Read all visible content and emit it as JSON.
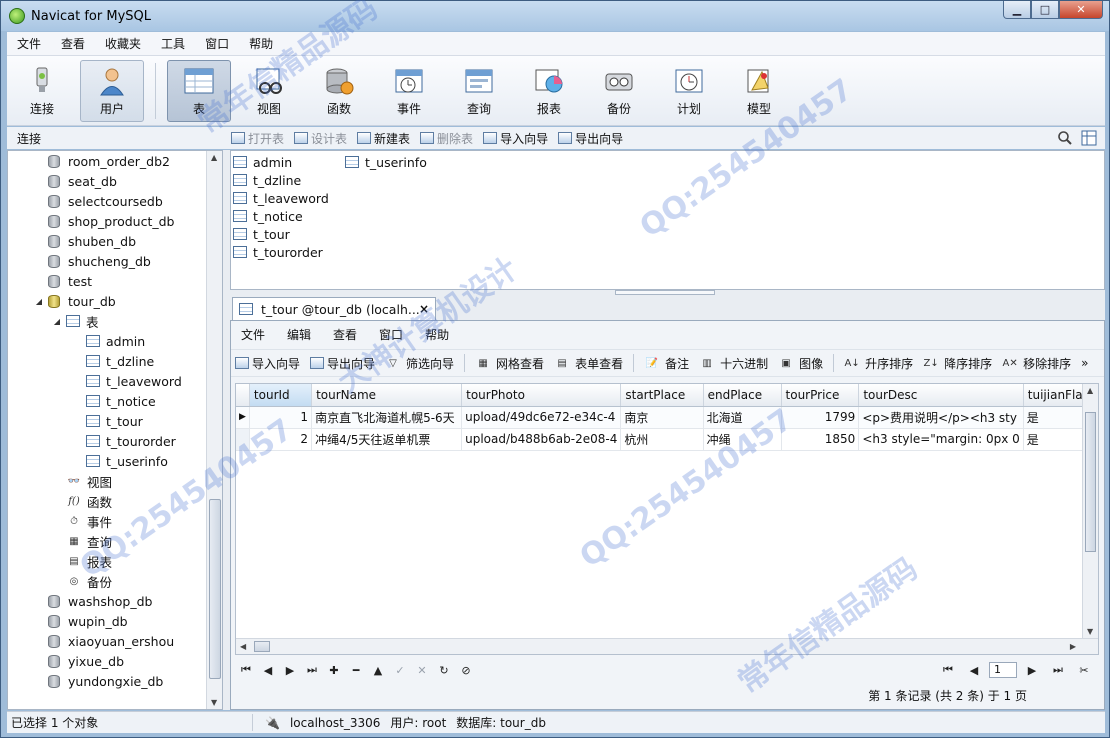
{
  "window": {
    "title": "Navicat for MySQL"
  },
  "menubar": [
    "文件",
    "查看",
    "收藏夹",
    "工具",
    "窗口",
    "帮助"
  ],
  "toolbar": {
    "connect": "连接",
    "user": "用户",
    "table": "表",
    "view": "视图",
    "function": "函数",
    "event": "事件",
    "query": "查询",
    "report": "报表",
    "backup": "备份",
    "schedule": "计划",
    "model": "模型"
  },
  "subtoolbar": {
    "connection_label": "连接",
    "open_table": "打开表",
    "design_table": "设计表",
    "new_table": "新建表",
    "delete_table": "删除表",
    "import_wizard": "导入向导",
    "export_wizard": "导出向导"
  },
  "tree": {
    "databases_before": [
      "room_order_db2",
      "seat_db",
      "selectcoursedb",
      "shop_product_db",
      "shuben_db",
      "shucheng_db",
      "test"
    ],
    "open_db": "tour_db",
    "tables_node": "表",
    "tables": [
      "admin",
      "t_dzline",
      "t_leaveword",
      "t_notice",
      "t_tour",
      "t_tourorder",
      "t_userinfo"
    ],
    "other_nodes": [
      "视图",
      "函数",
      "事件",
      "查询",
      "报表",
      "备份"
    ],
    "databases_after": [
      "washshop_db",
      "wupin_db",
      "xiaoyuan_ershou",
      "yixue_db",
      "yundongxie_db"
    ]
  },
  "objects": {
    "col1": [
      "admin",
      "t_dzline",
      "t_leaveword",
      "t_notice",
      "t_tour",
      "t_tourorder"
    ],
    "col2": [
      "t_userinfo"
    ]
  },
  "tab": {
    "label": "t_tour @tour_db (localh...",
    "close": "×"
  },
  "inner_menu": [
    "文件",
    "编辑",
    "查看",
    "窗口",
    "帮助"
  ],
  "inner_toolbar": {
    "import": "导入向导",
    "export": "导出向导",
    "filter": "筛选向导",
    "grid_view": "网格查看",
    "form_view": "表单查看",
    "memo": "备注",
    "hex": "十六进制",
    "image": "图像",
    "sort_asc": "升序排序",
    "sort_desc": "降序排序",
    "remove_sort": "移除排序"
  },
  "grid": {
    "columns": [
      "tourId",
      "tourName",
      "tourPhoto",
      "startPlace",
      "endPlace",
      "tourPrice",
      "tourDesc",
      "tuijianFlag"
    ],
    "rows": [
      [
        "1",
        "南京直飞北海道札幌5-6天",
        "upload/49dc6e72-e34c-4",
        "南京",
        "北海道",
        "1799",
        "<p>费用说明</p><h3 sty",
        "是"
      ],
      [
        "2",
        "冲绳4/5天往返单机票",
        "upload/b488b6ab-2e08-4",
        "杭州",
        "冲绳",
        "1850",
        "<h3 style=\"margin: 0px 0",
        "是"
      ]
    ]
  },
  "pager": {
    "current_page": "1"
  },
  "record_info": "第 1 条记录 (共 2 条) 于 1 页",
  "status": {
    "selection": "已选择 1 个对象",
    "host": "localhost_3306",
    "user": "用户: root",
    "database": "数据库: tour_db"
  },
  "watermark": {
    "line1": "QQ:254540457",
    "line2": "常年信精品源码",
    "line3": "大神计算机设计"
  },
  "colors": {
    "titlebar": "#b7d0ea",
    "selected_header": "#c3dcf2",
    "watermark": "#466ed2"
  }
}
